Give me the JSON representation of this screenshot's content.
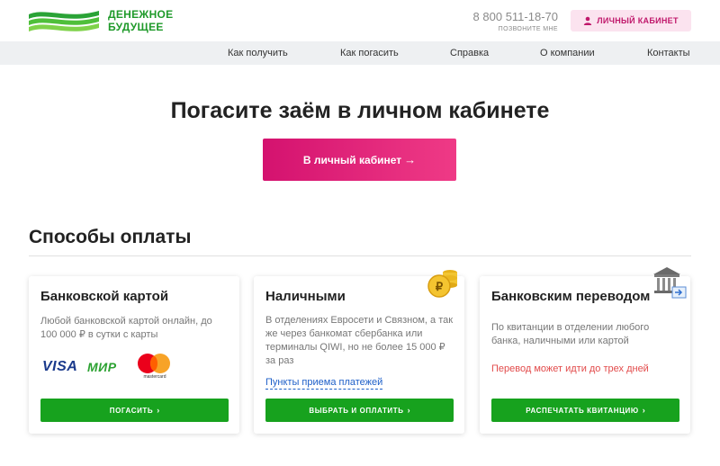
{
  "header": {
    "logo_line1": "ДЕНЕЖНОЕ",
    "logo_line2": "БУДУЩЕЕ",
    "phone": "8 800 511-18-70",
    "callback": "ПОЗВОНИТЕ МНЕ",
    "cabinet_label": "ЛИЧНЫЙ КАБИНЕТ",
    "cabinet_icon": "user-icon"
  },
  "nav": {
    "items": [
      "Как получить",
      "Как погасить",
      "Справка",
      "О компании",
      "Контакты"
    ]
  },
  "hero": {
    "title": "Погасите заём в личном кабинете",
    "button_label": "В личный кабинет",
    "button_arrow": "→"
  },
  "payments": {
    "title": "Способы оплаты",
    "cards": [
      {
        "title": "Банковской картой",
        "text_lines": [
          "Любой банковской картой онлайн, до",
          "100 000 ₽ в сутки с карты"
        ],
        "logos": {
          "visa": "VISA",
          "mir": "МИР",
          "mastercard": "mastercard"
        },
        "button_label": "ПОГАСИТЬ",
        "arrow": "›"
      },
      {
        "title": "Наличными",
        "text_lines": [
          "В отделениях Евросети и Связном, а так",
          "же через банкомат сбербанка или",
          "терминалы QIWI, но не более 15 000 ₽",
          "за раз"
        ],
        "link": "Пункты приема платежей",
        "icon": "ruble-coins-icon",
        "coin_symbol": "₽",
        "button_label": "ВЫБРАТЬ И ОПЛАТИТЬ",
        "arrow": "›"
      },
      {
        "title": "Банковским переводом",
        "text_lines": [
          "По квитанции в отделении любого",
          "банка, наличными или картой"
        ],
        "warning": "Перевод может идти до трех дней",
        "icon": "bank-icon",
        "button_label": "РАСПЕЧАТАТЬ КВИТАНЦИЮ",
        "arrow": "›"
      }
    ]
  },
  "colors": {
    "brand_green": "#1f9a2a",
    "button_green": "#17a21e",
    "accent_pink": "#d4126f",
    "warning_red": "#e24b4b",
    "link_blue": "#1d5fc8"
  }
}
